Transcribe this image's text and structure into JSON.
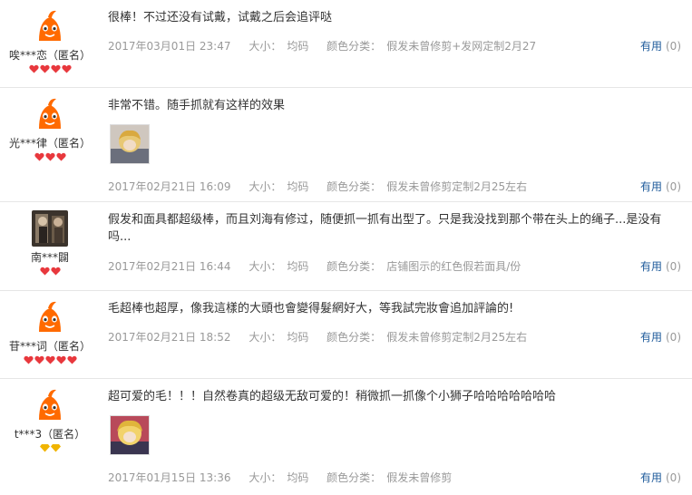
{
  "reviews": [
    {
      "user": "唉***恋（匿名）",
      "badge_type": "heart",
      "badge_count": 4,
      "text": "很棒！不过还没有试戴，试戴之后会追评哒",
      "date": "2017年03月01日 23:47",
      "size_label": "大小：",
      "size": "均码",
      "color_label": "颜色分类：",
      "color": "假发未曾修剪+发网定制2月27",
      "useful_label": "有用",
      "useful_count": "(0)"
    },
    {
      "user": "光***律（匿名）",
      "badge_type": "heart",
      "badge_count": 3,
      "text": "非常不错。随手抓就有这样的效果",
      "date": "2017年02月21日 16:09",
      "size_label": "大小：",
      "size": "均码",
      "color_label": "颜色分类：",
      "color": "假发未曾修剪定制2月25左右",
      "useful_label": "有用",
      "useful_count": "(0)"
    },
    {
      "user": "南***闢",
      "badge_type": "heart",
      "badge_count": 2,
      "text": "假发和面具都超级棒，而且刘海有修过，随便抓一抓有出型了。只是我没找到那个带在头上的绳子...是没有吗...",
      "date": "2017年02月21日 16:44",
      "size_label": "大小：",
      "size": "均码",
      "color_label": "颜色分类：",
      "color": "店铺图示的红色假若面具/份",
      "useful_label": "有用",
      "useful_count": "(0)"
    },
    {
      "user": "苷***词（匿名）",
      "badge_type": "heart",
      "badge_count": 5,
      "text": "毛超棒也超厚，像我這樣的大頭也會變得髮網好大，等我試完妝會追加評論的!",
      "date": "2017年02月21日 18:52",
      "size_label": "大小：",
      "size": "均码",
      "color_label": "颜色分类：",
      "color": "假发未曾修剪定制2月25左右",
      "useful_label": "有用",
      "useful_count": "(0)"
    },
    {
      "user": "t***3（匿名）",
      "badge_type": "diamond",
      "badge_count": 2,
      "text": "超可爱的毛！！！自然卷真的超级无敌可爱的！稍微抓一抓像个小狮子哈哈哈哈哈哈哈",
      "date": "2017年01月15日 13:36",
      "size_label": "大小：",
      "size": "均码",
      "color_label": "颜色分类：",
      "color": "假发未曾修剪",
      "useful_label": "有用",
      "useful_count": "(0)"
    }
  ],
  "colors": {
    "heart": "#e8383d",
    "diamond": "#f0b400",
    "link": "#1f5b9b",
    "muted": "#999999"
  }
}
